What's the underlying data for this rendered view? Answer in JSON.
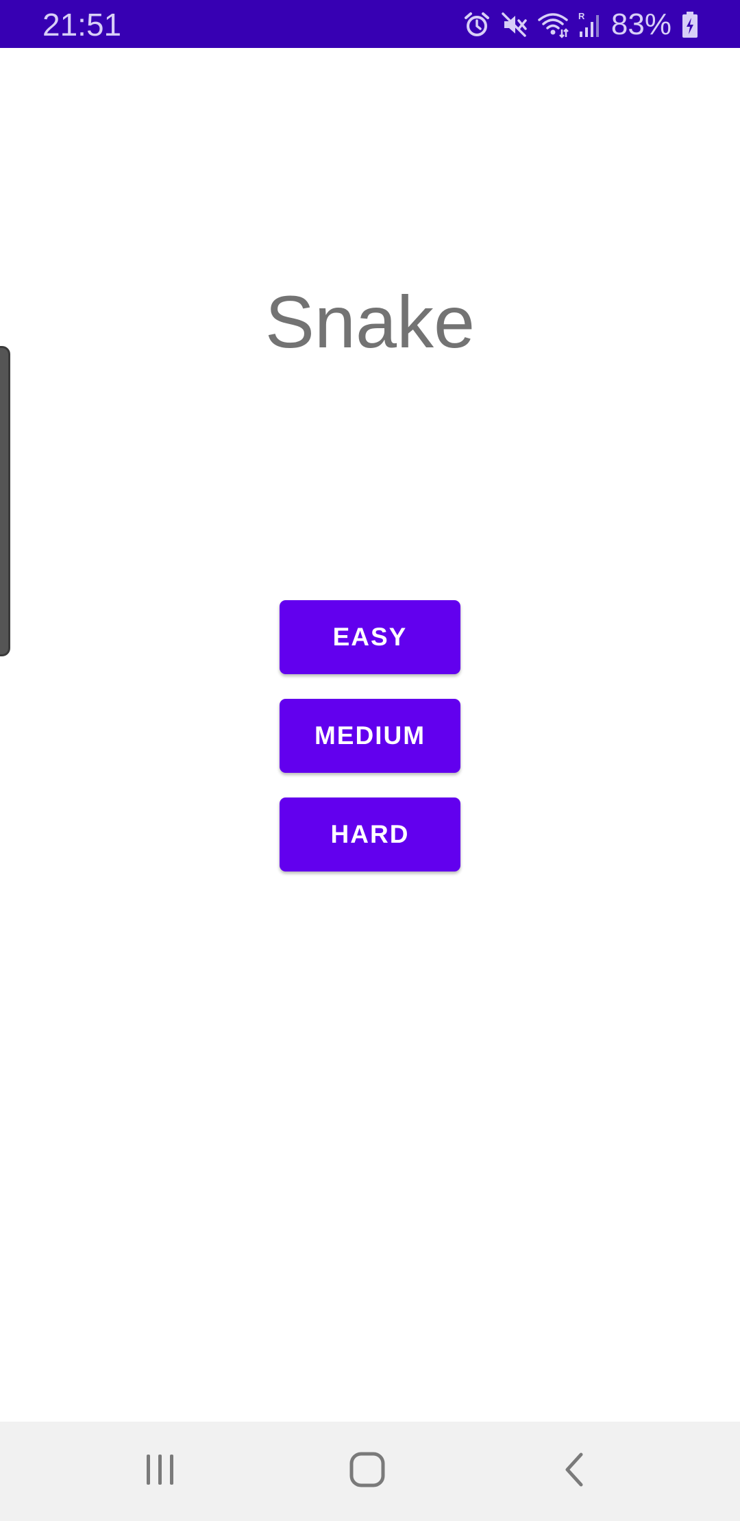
{
  "status_bar": {
    "time": "21:51",
    "battery_percent": "83%",
    "background_color": "#3700b3",
    "icons": [
      "alarm-icon",
      "mute-icon",
      "wifi-icon",
      "signal-icon",
      "battery-charging-icon"
    ]
  },
  "app": {
    "title": "Snake",
    "accent_color": "#6200ee"
  },
  "difficulty_buttons": {
    "easy_label": "EASY",
    "medium_label": "MEDIUM",
    "hard_label": "HARD"
  },
  "nav_bar": {
    "icons": [
      "recents-icon",
      "home-icon",
      "back-icon"
    ]
  }
}
